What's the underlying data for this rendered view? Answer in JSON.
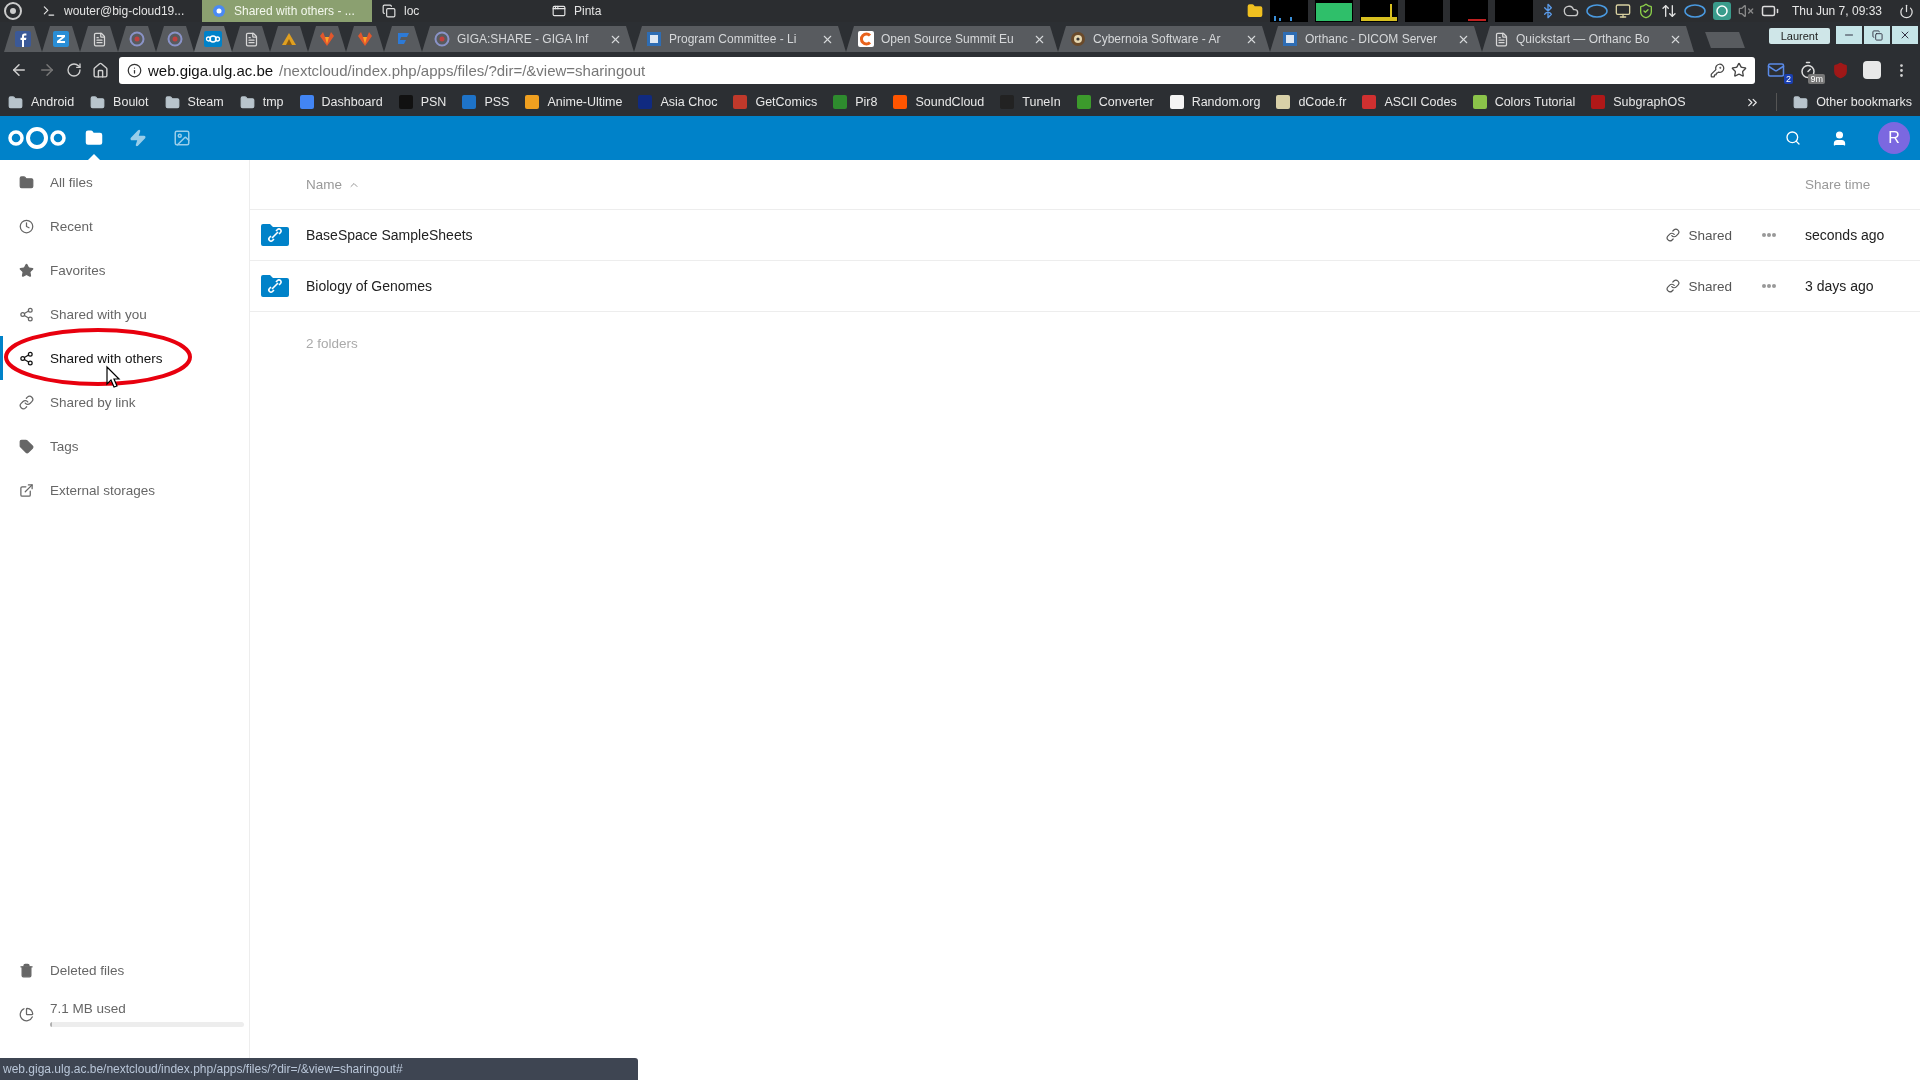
{
  "taskbar": {
    "tasks": [
      {
        "label": "wouter@big-cloud19...",
        "kind": "terminal",
        "selected": false
      },
      {
        "label": "Shared with others - ...",
        "kind": "browser",
        "selected": true
      },
      {
        "label": "loc",
        "kind": "files",
        "selected": false
      },
      {
        "label": "Pinta",
        "kind": "window",
        "selected": false
      }
    ],
    "clock": "Thu Jun  7, 09:33"
  },
  "browser": {
    "pinned_tabs": [
      {
        "kind": "facebook",
        "selected": false
      },
      {
        "kind": "zotero",
        "selected": false
      },
      {
        "kind": "page",
        "selected": false
      },
      {
        "kind": "target",
        "selected": false
      },
      {
        "kind": "target",
        "selected": false
      },
      {
        "kind": "nextcloud",
        "selected": true
      },
      {
        "kind": "page",
        "selected": false
      },
      {
        "kind": "peak",
        "selected": false
      },
      {
        "kind": "fox",
        "selected": false
      },
      {
        "kind": "fox",
        "selected": false
      },
      {
        "kind": "flag",
        "selected": false
      }
    ],
    "tabs": [
      {
        "title": "GIGA:SHARE - GIGA Inf",
        "kind": "target",
        "selected": false
      },
      {
        "title": "Program Committee - Li",
        "kind": "square",
        "selected": false
      },
      {
        "title": "Open Source Summit Eu",
        "kind": "orange",
        "selected": false
      },
      {
        "title": "Cybernoia Software - Ar",
        "kind": "gear",
        "selected": false
      },
      {
        "title": "Orthanc - DICOM Server",
        "kind": "square",
        "selected": false
      },
      {
        "title": "Quickstart — Orthanc Bo",
        "kind": "page",
        "selected": false
      }
    ],
    "profile": "Laurent",
    "address": {
      "host": "web.giga.ulg.ac.be",
      "path": "/nextcloud/index.php/apps/files/?dir=/&view=sharingout"
    },
    "extensions": [
      {
        "kind": "mail",
        "badge": "2"
      },
      {
        "kind": "timer",
        "badge": "9m"
      },
      {
        "kind": "shield"
      },
      {
        "kind": "circle"
      }
    ],
    "bookmarks": [
      {
        "label": "Android",
        "kind": "folder"
      },
      {
        "label": "Boulot",
        "kind": "folder"
      },
      {
        "label": "Steam",
        "kind": "folder"
      },
      {
        "label": "tmp",
        "kind": "folder"
      },
      {
        "label": "Dashboard",
        "kind": "site",
        "color": "#4285f4"
      },
      {
        "label": "PSN",
        "kind": "site",
        "color": "#111111"
      },
      {
        "label": "PSS",
        "kind": "site",
        "color": "#1e73c8"
      },
      {
        "label": "Anime-Ultime",
        "kind": "site",
        "color": "#f0a020"
      },
      {
        "label": "Asia Choc",
        "kind": "site",
        "color": "#102a80"
      },
      {
        "label": "GetComics",
        "kind": "site",
        "color": "#c0392b"
      },
      {
        "label": "Pir8",
        "kind": "site",
        "color": "#2e8b2e"
      },
      {
        "label": "SoundCloud",
        "kind": "site",
        "color": "#ff5500"
      },
      {
        "label": "TuneIn",
        "kind": "site",
        "color": "#222222"
      },
      {
        "label": "Converter",
        "kind": "site",
        "color": "#3c9a2c"
      },
      {
        "label": "Random.org",
        "kind": "site",
        "color": "#f4f4f4"
      },
      {
        "label": "dCode.fr",
        "kind": "site",
        "color": "#d8d0a8"
      },
      {
        "label": "ASCII Codes",
        "kind": "site",
        "color": "#d03030"
      },
      {
        "label": "Colors Tutorial",
        "kind": "site",
        "color": "#8bc34a"
      },
      {
        "label": "SubgraphOS",
        "kind": "site",
        "color": "#b01818"
      }
    ],
    "other_bookmarks": "Other bookmarks"
  },
  "nextcloud": {
    "apps": [
      {
        "kind": "files",
        "selected": true
      },
      {
        "kind": "activity",
        "selected": false
      },
      {
        "kind": "gallery",
        "selected": false
      }
    ],
    "avatar": "R",
    "sidebar": {
      "items": [
        {
          "label": "All files",
          "kind": "folder",
          "selected": false
        },
        {
          "label": "Recent",
          "kind": "clock",
          "selected": false
        },
        {
          "label": "Favorites",
          "kind": "star",
          "selected": false
        },
        {
          "label": "Shared with you",
          "kind": "share",
          "selected": false
        },
        {
          "label": "Shared with others",
          "kind": "share",
          "selected": true
        },
        {
          "label": "Shared by link",
          "kind": "link",
          "selected": false
        },
        {
          "label": "Tags",
          "kind": "tag",
          "selected": false
        },
        {
          "label": "External storages",
          "kind": "external",
          "selected": false
        }
      ],
      "deleted": "Deleted files",
      "quota": {
        "label": "7.1 MB used",
        "level": 0.01
      }
    },
    "table": {
      "columns": {
        "name": "Name",
        "share_time": "Share time"
      },
      "rows": [
        {
          "name": "BaseSpace SampleSheets",
          "share": "Shared",
          "time": "seconds ago"
        },
        {
          "name": "Biology of Genomes",
          "share": "Shared",
          "time": "3 days ago"
        }
      ],
      "summary": "2 folders"
    }
  },
  "status_url": "web.giga.ulg.ac.be/nextcloud/index.php/apps/files/?dir=/&view=sharingout#"
}
